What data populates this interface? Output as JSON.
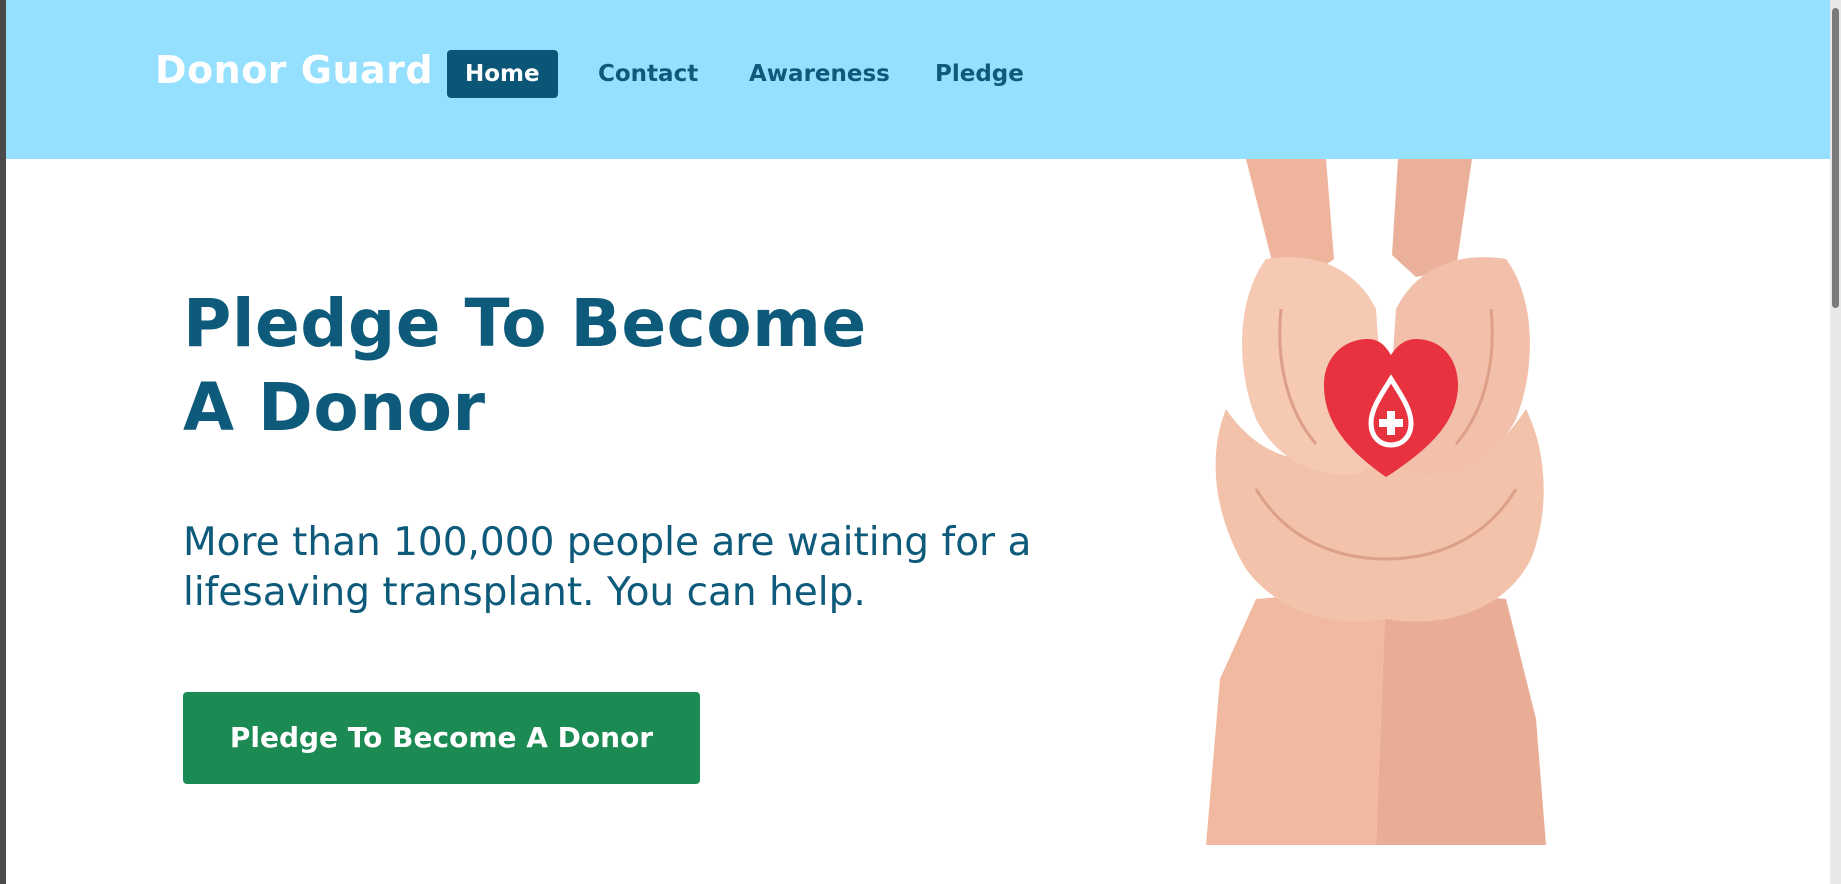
{
  "brand": {
    "name": "Donor Guard"
  },
  "nav": {
    "items": [
      {
        "label": "Home",
        "active": true
      },
      {
        "label": "Contact",
        "active": false
      },
      {
        "label": "Awareness",
        "active": false
      },
      {
        "label": "Pledge",
        "active": false
      }
    ]
  },
  "hero": {
    "title_line1": "Pledge To Become",
    "title_line2": "A Donor",
    "subtitle": "More than 100,000 people are waiting for a lifesaving transplant. You can help.",
    "cta_label": "Pledge To Become A Donor",
    "image_icon": "hands-holding-heart-blood-drop"
  },
  "colors": {
    "navbar_bg": "#94e0fe",
    "primary_text": "#0d5a7b",
    "active_nav_bg": "#0b5576",
    "cta_bg": "#1b8a53",
    "heart": "#e8323f"
  }
}
